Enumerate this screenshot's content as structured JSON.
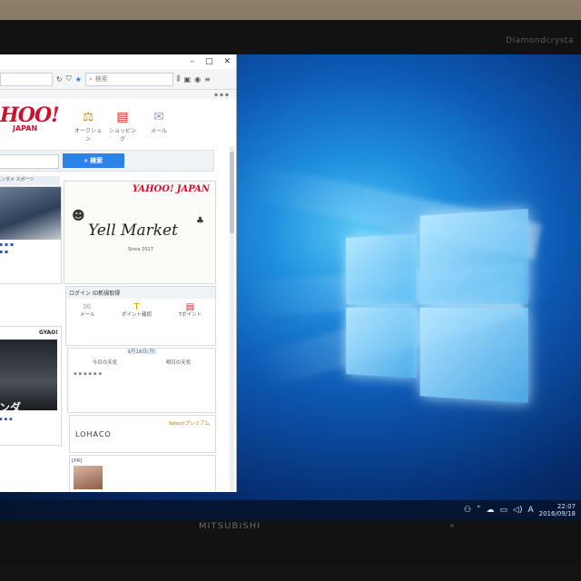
{
  "monitor": {
    "brand_top": "Diamondcrysta",
    "brand_bottom": "MITSUBISHI"
  },
  "browser": {
    "window_controls": {
      "minimize": "–",
      "maximize": "□",
      "close": "✕"
    },
    "search_placeholder": "検索",
    "yahoo_logo": "HOO!",
    "yahoo_sub": "JAPAN",
    "services": [
      {
        "label": "オークション",
        "icon": "auction-icon"
      },
      {
        "label": "ショッピング",
        "icon": "shopping-icon"
      },
      {
        "label": "メール",
        "icon": "mail-icon"
      }
    ],
    "search_button": "検索",
    "news_tabs": "エンタメ  スポーツ",
    "promo_label": "YAHOO! JAPAN",
    "promo_title": "Yell Market",
    "promo_date": "Since 2017",
    "login_header": "ログイン  ID新規取得",
    "login_icons": [
      "メール",
      "ポイント確認",
      "Tポイント"
    ],
    "weather_date": "9月18日(月)",
    "weather": [
      "今日の天気",
      "明日の天気"
    ],
    "gyao_label": "GYAO!",
    "lohaco": "LOHACO",
    "premium": "Yahoo!プレミアム",
    "pr_label": "[PR]"
  },
  "taskbar": {
    "time": "22:07",
    "date": "2016/09/18"
  },
  "colors": {
    "yahoo_red": "#d00f2c",
    "search_blue": "#2c82e6",
    "desktop_blue": "#1f8fde"
  }
}
